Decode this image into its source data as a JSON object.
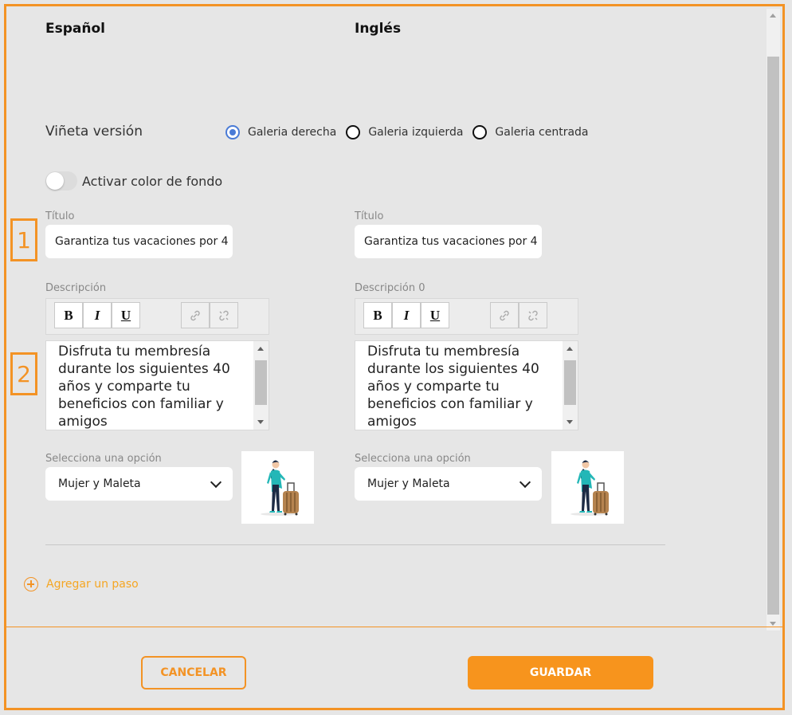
{
  "columns": {
    "left_header": "Español",
    "right_header": "Inglés"
  },
  "vineta": {
    "label": "Viñeta versión",
    "options": [
      {
        "label": "Galeria derecha",
        "checked": true
      },
      {
        "label": "Galeria izquierda",
        "checked": false
      },
      {
        "label": "Galeria centrada",
        "checked": false
      }
    ]
  },
  "bg_toggle": {
    "label": "Activar color de fondo",
    "on": false
  },
  "left": {
    "title_label": "Título",
    "title_value": "Garantiza tus vacaciones por 4",
    "desc_label": "Descripción",
    "desc_text": "Disfruta tu membresía durante los siguientes 40 años y comparte tu beneficios con familiar y amigos",
    "select_label": "Selecciona una opción",
    "select_value": "Mujer y Maleta"
  },
  "right": {
    "title_label": "Título",
    "title_value": "Garantiza tus vacaciones por 4",
    "desc_label": "Descripción 0",
    "desc_text": "Disfruta tu membresía durante los siguientes 40 años y comparte tu beneficios con familiar y amigos",
    "select_label": "Selecciona una opción",
    "select_value": "Mujer y Maleta"
  },
  "toolbar": {
    "bold": "B",
    "italic": "I",
    "underline": "U"
  },
  "markers": {
    "one": "1",
    "two": "2"
  },
  "add_step": "Agregar un paso",
  "buttons": {
    "cancel": "CANCELAR",
    "save": "GUARDAR"
  },
  "colors": {
    "accent": "#f39325",
    "radio_checked": "#4a7bd6"
  }
}
